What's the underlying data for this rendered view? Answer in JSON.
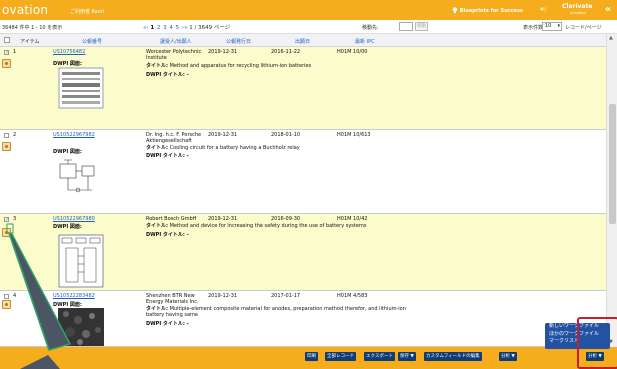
{
  "header": {
    "brand": "ovation",
    "welcome": "ご利用者 Kaori",
    "blueprints": "Blueprints for Success",
    "lang": "#|",
    "clarivate": "Clarivate",
    "clarivate_sub": "Analytics",
    "collapse": "«"
  },
  "controls": {
    "count": "36484 件中 1 - 10 を表示",
    "pager_prev": "«‹",
    "pages": [
      "1",
      "2",
      "3",
      "4",
      "5"
    ],
    "pager_next": "›»",
    "page_info": "1 / 3649 ページ",
    "move_label": "移動先:",
    "move_button": "移動",
    "perpage_label": "表示件数",
    "perpage_value": "10",
    "perpage_suffix": "レコード/ページ"
  },
  "columns": {
    "item": "アイテム",
    "pub_no": "公報番号",
    "assignee": "譲受人/出願人",
    "pub_date": "公報発行日",
    "app_date": "出願日",
    "ipc": "最新 IPC"
  },
  "rows": [
    {
      "index": "1",
      "pub_no": "US10756482",
      "dwpi_label": "DWPI 図面:",
      "assignee": "Worcester Polytechnic Institute",
      "pub_date": "2019-12-31",
      "app_date": "2016-11-22",
      "ipc": "H01M 10/00",
      "title_prefix": "タイトル:",
      "title": "Method and apparatus for recycling lithium-ion batteries",
      "dwpi_title": "DWPI タイトル: -"
    },
    {
      "index": "2",
      "pub_no": "US10522967982",
      "dwpi_label": "DWPI 図面:",
      "assignee": "Dr. Ing. h.c. F. Porsche Aktiengesellschaft",
      "pub_date": "2019-12-31",
      "app_date": "2018-01-10",
      "ipc": "H01M 10/613",
      "title_prefix": "タイトル:",
      "title": "Cooling circuit for a battery having a Buchholz relay",
      "dwpi_title": "DWPI タイトル: -"
    },
    {
      "index": "3",
      "pub_no": "US10522967980",
      "dwpi_label": "DWPI 図面:",
      "assignee": "Robert Bosch GmbH",
      "pub_date": "2019-12-31",
      "app_date": "2016-09-30",
      "ipc": "H01M 10/42",
      "title_prefix": "タイトル:",
      "title": "Method and device for increasing the safety during the use of battery systems",
      "dwpi_title": "DWPI タイトル: -"
    },
    {
      "index": "4",
      "pub_no": "US10522283482",
      "dwpi_label": "DWPI 図面:",
      "assignee": "Shenzhen BTR New Energy Materials Inc.",
      "pub_date": "2019-12-31",
      "app_date": "2017-01-17",
      "ipc": "H01M 4/583",
      "title_prefix": "タイトル:",
      "title": "Multiple-element composite material for anodes, preparation method therefor, and lithium-ion battery having same",
      "dwpi_title": "DWPI タイトル: -"
    }
  ],
  "bottom_buttons": [
    "印刷",
    "全部レコード",
    "エクスポート",
    "保存 ▼",
    "カスタムフィールドの編集",
    "分析 ▼",
    "分析 ▼"
  ],
  "popup": {
    "items": [
      "新しいワークファイル",
      "ほかのワークファイル",
      "マークリスト"
    ]
  },
  "colors": {
    "brand_orange": "#f5ad1d",
    "link_blue": "#1f62c4",
    "row_highlight": "#fbfbcc",
    "button_navy": "#0e3c75",
    "popup_blue": "#2452a3",
    "annotation_red": "#c71d2c",
    "callout_green": "#2fa56a"
  }
}
